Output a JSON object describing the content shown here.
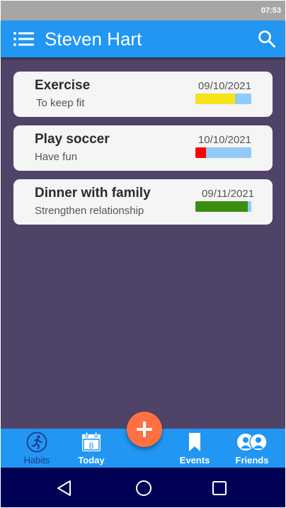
{
  "status_bar": {
    "time": "07:53"
  },
  "app_bar": {
    "title": "Steven Hart",
    "menu_icon": "hamburger-menu-icon",
    "search_icon": "search-icon"
  },
  "habits": [
    {
      "title": "Exercise",
      "subtitle": "To keep fit",
      "date": "09/10/2021",
      "progress": 0.71,
      "progress_color": "#f5e31c"
    },
    {
      "title": "Play soccer",
      "subtitle": "Have fun",
      "date": "10/10/2021",
      "progress": 0.19,
      "progress_color": "#ff0000"
    },
    {
      "title": "Dinner with family",
      "subtitle": "Strengthen relationship",
      "date": "09/11/2021",
      "progress": 0.94,
      "progress_color": "#3a8f12"
    }
  ],
  "bottom_nav": [
    {
      "label": "Habits",
      "icon": "running-person-icon"
    },
    {
      "label": "Today",
      "icon": "calendar-icon",
      "calendar_day": "8"
    },
    {
      "label": "Events",
      "icon": "bookmark-icon"
    },
    {
      "label": "Friends",
      "icon": "friends-icon"
    }
  ],
  "fab": {
    "icon": "plus-icon"
  },
  "system_nav": {
    "back_icon": "back-triangle-icon",
    "home_icon": "home-circle-icon",
    "recents_icon": "recents-square-icon"
  },
  "colors": {
    "primary": "#2196f3",
    "background": "#4f4467",
    "fab": "#ff7043",
    "progress_track": "#90caf9",
    "system_nav": "#000155"
  }
}
